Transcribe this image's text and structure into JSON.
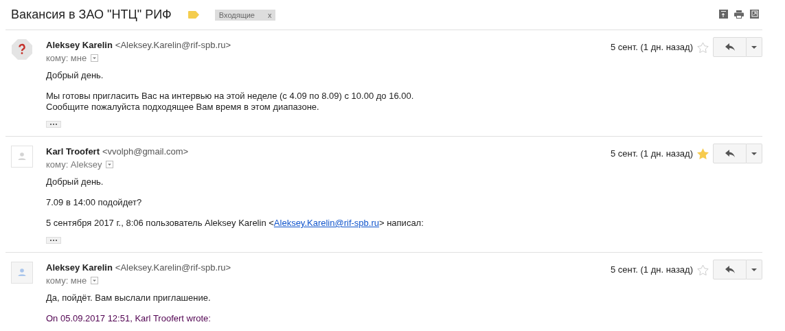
{
  "subject": {
    "title": "Вакансия в ЗАО \"НТЦ\" РИФ",
    "important": true,
    "labels": [
      {
        "name": "Входящие",
        "remove": "x"
      }
    ]
  },
  "messages": [
    {
      "avatar": {
        "kind": "unknown"
      },
      "sender": "Aleksey Karelin",
      "email": "<Aleksey.Karelin@rif-spb.ru>",
      "to": "кому: мне",
      "date": "5 сент. (1 дн. назад)",
      "starred": false,
      "paragraphs": [
        {
          "kind": "text",
          "lines": [
            "Добрый день."
          ]
        },
        {
          "kind": "text",
          "lines": [
            "Мы готовы пригласить Вас на интервью на этой неделе (с 4.09 по 8.09) с 10.00 до 16.00.",
            "Сообщите пожалуйста подходящее Вам время в этом диапазоне."
          ]
        }
      ],
      "trimmed": true
    },
    {
      "avatar": {
        "kind": "contact"
      },
      "sender": "Karl Troofert",
      "email": "<vvolph@gmail.com>",
      "to": "кому: Aleksey",
      "date": "5 сент. (1 дн. назад)",
      "starred": true,
      "paragraphs": [
        {
          "kind": "text",
          "lines": [
            "Добрый день."
          ]
        },
        {
          "kind": "text",
          "lines": [
            "7.09 в 14:00 подойдет?"
          ]
        },
        {
          "kind": "attribution",
          "before": "5 сентября 2017 г., 8:06 пользователь Aleksey Karelin <",
          "link": "Aleksey.Karelin@rif-spb.ru",
          "after": "> написал:"
        }
      ],
      "trimmed": true
    },
    {
      "avatar": {
        "kind": "self"
      },
      "sender": "Aleksey Karelin",
      "email": "<Aleksey.Karelin@rif-spb.ru>",
      "to": "кому: мне",
      "date": "5 сент. (1 дн. назад)",
      "starred": false,
      "paragraphs": [
        {
          "kind": "text",
          "lines": [
            "Да, пойдёт. Вам выслали приглашение."
          ]
        },
        {
          "kind": "quote-header",
          "lines": [
            "On 05.09.2017 12:51, Karl Troofert wrote:"
          ]
        }
      ],
      "trimmed": false
    }
  ]
}
